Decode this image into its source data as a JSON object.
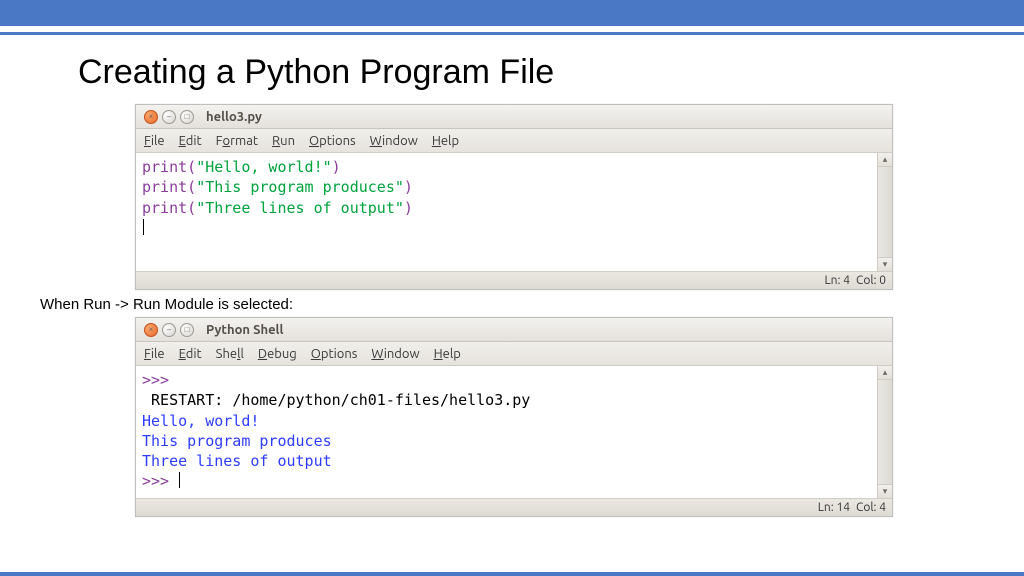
{
  "slide": {
    "title": "Creating a Python Program File",
    "caption": "When Run -> Run Module is selected:"
  },
  "editor": {
    "title": "hello3.py",
    "menus": [
      "File",
      "Edit",
      "Format",
      "Run",
      "Options",
      "Window",
      "Help"
    ],
    "lines": [
      {
        "fn": "print",
        "open": "(",
        "str": "\"Hello, world!\"",
        "close": ")"
      },
      {
        "fn": "print",
        "open": "(",
        "str": "\"This program produces\"",
        "close": ")"
      },
      {
        "fn": "print",
        "open": "(",
        "str": "\"Three lines of output\"",
        "close": ")"
      }
    ],
    "status": {
      "ln": "Ln: 4",
      "col": "Col: 0"
    }
  },
  "shell": {
    "title": "Python Shell",
    "menus": [
      "File",
      "Edit",
      "Shell",
      "Debug",
      "Options",
      "Window",
      "Help"
    ],
    "prompt": ">>>",
    "restart1": " RESTART: ",
    "restart2": "/home/python/ch01-files/hello3.py ",
    "out": [
      "Hello, world!",
      "This program produces",
      "Three lines of output"
    ],
    "status": {
      "ln": "Ln: 14",
      "col": "Col: 4"
    }
  }
}
